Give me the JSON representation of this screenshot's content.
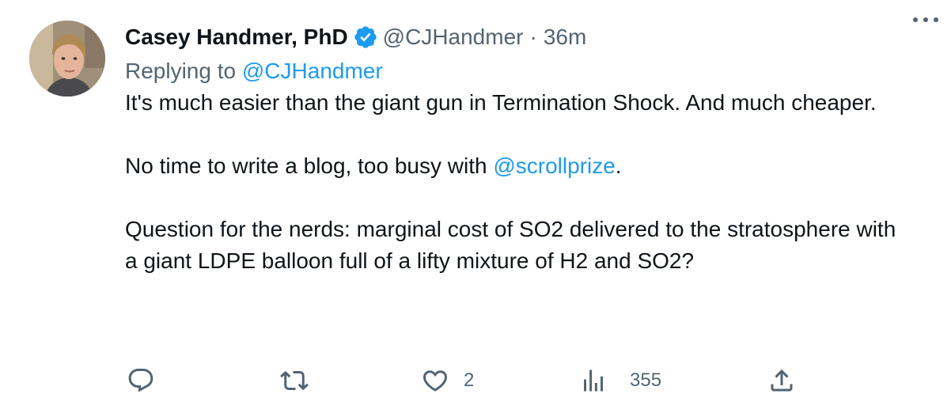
{
  "author": {
    "name": "Casey Handmer, PhD",
    "handle": "@CJHandmer",
    "separator": "·",
    "time": "36m",
    "verified": true
  },
  "replying": {
    "prefix": "Replying to",
    "handle": "@CJHandmer"
  },
  "tweet": {
    "para1": "It's much easier than the giant gun in Termination Shock. And much cheaper.",
    "para2_before": "No time to write a blog, too busy with ",
    "para2_link": "@scrollprize",
    "para2_after": ".",
    "para3": "Question for the nerds: marginal cost of SO2 delivered to the stratosphere with a giant LDPE balloon full of a lifty mixture of H2 and SO2?"
  },
  "actions": {
    "reply_icon": "reply-icon",
    "retweet_icon": "retweet-icon",
    "like_icon": "heart-icon",
    "like_count": "2",
    "views_icon": "views-icon",
    "views_count": "355",
    "share_icon": "share-icon"
  },
  "colors": {
    "link": "#1d9bf0",
    "secondary": "#536471",
    "text": "#0f1419"
  }
}
